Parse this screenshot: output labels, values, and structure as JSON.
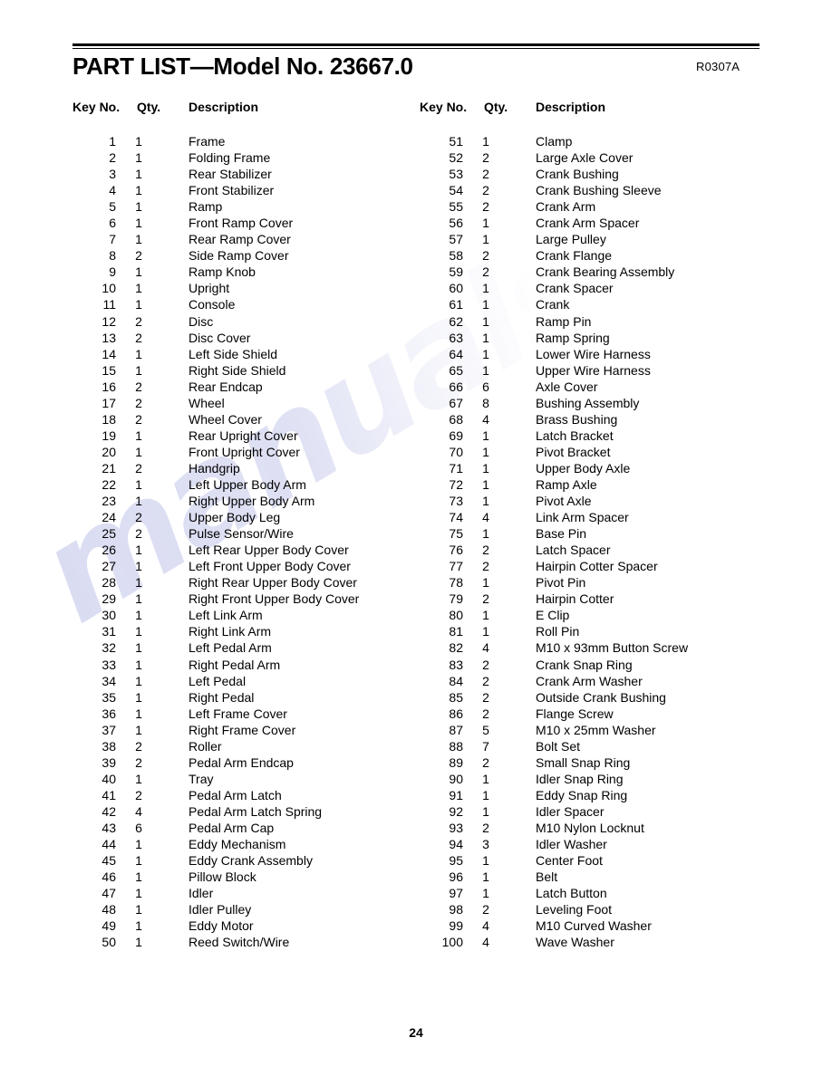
{
  "document": {
    "title": "PART LIST—Model No. 23667.0",
    "revision": "R0307A",
    "page_number": "24",
    "watermark": "manuals"
  },
  "columns": {
    "headers": {
      "key_no": "Key No.",
      "qty": "Qty.",
      "description": "Description"
    }
  },
  "parts_left": [
    {
      "key": "1",
      "qty": "1",
      "desc": "Frame"
    },
    {
      "key": "2",
      "qty": "1",
      "desc": "Folding Frame"
    },
    {
      "key": "3",
      "qty": "1",
      "desc": "Rear Stabilizer"
    },
    {
      "key": "4",
      "qty": "1",
      "desc": "Front Stabilizer"
    },
    {
      "key": "5",
      "qty": "1",
      "desc": "Ramp"
    },
    {
      "key": "6",
      "qty": "1",
      "desc": "Front Ramp Cover"
    },
    {
      "key": "7",
      "qty": "1",
      "desc": "Rear Ramp Cover"
    },
    {
      "key": "8",
      "qty": "2",
      "desc": "Side Ramp Cover"
    },
    {
      "key": "9",
      "qty": "1",
      "desc": "Ramp Knob"
    },
    {
      "key": "10",
      "qty": "1",
      "desc": "Upright"
    },
    {
      "key": "11",
      "qty": "1",
      "desc": "Console"
    },
    {
      "key": "12",
      "qty": "2",
      "desc": "Disc"
    },
    {
      "key": "13",
      "qty": "2",
      "desc": "Disc Cover"
    },
    {
      "key": "14",
      "qty": "1",
      "desc": "Left Side Shield"
    },
    {
      "key": "15",
      "qty": "1",
      "desc": "Right Side Shield"
    },
    {
      "key": "16",
      "qty": "2",
      "desc": "Rear Endcap"
    },
    {
      "key": "17",
      "qty": "2",
      "desc": "Wheel"
    },
    {
      "key": "18",
      "qty": "2",
      "desc": "Wheel Cover"
    },
    {
      "key": "19",
      "qty": "1",
      "desc": "Rear Upright Cover"
    },
    {
      "key": "20",
      "qty": "1",
      "desc": "Front Upright Cover"
    },
    {
      "key": "21",
      "qty": "2",
      "desc": "Handgrip"
    },
    {
      "key": "22",
      "qty": "1",
      "desc": "Left Upper Body Arm"
    },
    {
      "key": "23",
      "qty": "1",
      "desc": "Right Upper Body Arm"
    },
    {
      "key": "24",
      "qty": "2",
      "desc": "Upper Body Leg"
    },
    {
      "key": "25",
      "qty": "2",
      "desc": "Pulse Sensor/Wire"
    },
    {
      "key": "26",
      "qty": "1",
      "desc": "Left Rear Upper Body Cover"
    },
    {
      "key": "27",
      "qty": "1",
      "desc": "Left Front Upper Body Cover"
    },
    {
      "key": "28",
      "qty": "1",
      "desc": "Right Rear Upper Body Cover"
    },
    {
      "key": "29",
      "qty": "1",
      "desc": "Right Front Upper Body Cover"
    },
    {
      "key": "30",
      "qty": "1",
      "desc": "Left Link Arm"
    },
    {
      "key": "31",
      "qty": "1",
      "desc": "Right Link Arm"
    },
    {
      "key": "32",
      "qty": "1",
      "desc": "Left Pedal Arm"
    },
    {
      "key": "33",
      "qty": "1",
      "desc": "Right Pedal Arm"
    },
    {
      "key": "34",
      "qty": "1",
      "desc": "Left Pedal"
    },
    {
      "key": "35",
      "qty": "1",
      "desc": "Right Pedal"
    },
    {
      "key": "36",
      "qty": "1",
      "desc": "Left Frame Cover"
    },
    {
      "key": "37",
      "qty": "1",
      "desc": "Right Frame Cover"
    },
    {
      "key": "38",
      "qty": "2",
      "desc": "Roller"
    },
    {
      "key": "39",
      "qty": "2",
      "desc": "Pedal Arm Endcap"
    },
    {
      "key": "40",
      "qty": "1",
      "desc": "Tray"
    },
    {
      "key": "41",
      "qty": "2",
      "desc": "Pedal Arm Latch"
    },
    {
      "key": "42",
      "qty": "4",
      "desc": "Pedal Arm Latch Spring"
    },
    {
      "key": "43",
      "qty": "6",
      "desc": "Pedal Arm Cap"
    },
    {
      "key": "44",
      "qty": "1",
      "desc": "Eddy Mechanism"
    },
    {
      "key": "45",
      "qty": "1",
      "desc": "Eddy Crank Assembly"
    },
    {
      "key": "46",
      "qty": "1",
      "desc": "Pillow Block"
    },
    {
      "key": "47",
      "qty": "1",
      "desc": "Idler"
    },
    {
      "key": "48",
      "qty": "1",
      "desc": "Idler Pulley"
    },
    {
      "key": "49",
      "qty": "1",
      "desc": "Eddy Motor"
    },
    {
      "key": "50",
      "qty": "1",
      "desc": "Reed Switch/Wire"
    }
  ],
  "parts_right": [
    {
      "key": "51",
      "qty": "1",
      "desc": "Clamp"
    },
    {
      "key": "52",
      "qty": "2",
      "desc": "Large Axle Cover"
    },
    {
      "key": "53",
      "qty": "2",
      "desc": "Crank Bushing"
    },
    {
      "key": "54",
      "qty": "2",
      "desc": "Crank Bushing Sleeve"
    },
    {
      "key": "55",
      "qty": "2",
      "desc": "Crank Arm"
    },
    {
      "key": "56",
      "qty": "1",
      "desc": "Crank Arm Spacer"
    },
    {
      "key": "57",
      "qty": "1",
      "desc": "Large Pulley"
    },
    {
      "key": "58",
      "qty": "2",
      "desc": "Crank Flange"
    },
    {
      "key": "59",
      "qty": "2",
      "desc": "Crank Bearing Assembly"
    },
    {
      "key": "60",
      "qty": "1",
      "desc": "Crank Spacer"
    },
    {
      "key": "61",
      "qty": "1",
      "desc": "Crank"
    },
    {
      "key": "62",
      "qty": "1",
      "desc": "Ramp Pin"
    },
    {
      "key": "63",
      "qty": "1",
      "desc": "Ramp Spring"
    },
    {
      "key": "64",
      "qty": "1",
      "desc": "Lower Wire Harness"
    },
    {
      "key": "65",
      "qty": "1",
      "desc": "Upper Wire Harness"
    },
    {
      "key": "66",
      "qty": "6",
      "desc": "Axle Cover"
    },
    {
      "key": "67",
      "qty": "8",
      "desc": "Bushing Assembly"
    },
    {
      "key": "68",
      "qty": "4",
      "desc": "Brass Bushing"
    },
    {
      "key": "69",
      "qty": "1",
      "desc": "Latch Bracket"
    },
    {
      "key": "70",
      "qty": "1",
      "desc": "Pivot Bracket"
    },
    {
      "key": "71",
      "qty": "1",
      "desc": "Upper Body Axle"
    },
    {
      "key": "72",
      "qty": "1",
      "desc": "Ramp Axle"
    },
    {
      "key": "73",
      "qty": "1",
      "desc": "Pivot Axle"
    },
    {
      "key": "74",
      "qty": "4",
      "desc": "Link Arm Spacer"
    },
    {
      "key": "75",
      "qty": "1",
      "desc": "Base Pin"
    },
    {
      "key": "76",
      "qty": "2",
      "desc": "Latch Spacer"
    },
    {
      "key": "77",
      "qty": "2",
      "desc": "Hairpin Cotter Spacer"
    },
    {
      "key": "78",
      "qty": "1",
      "desc": "Pivot Pin"
    },
    {
      "key": "79",
      "qty": "2",
      "desc": "Hairpin Cotter"
    },
    {
      "key": "80",
      "qty": "1",
      "desc": "E Clip"
    },
    {
      "key": "81",
      "qty": "1",
      "desc": "Roll Pin"
    },
    {
      "key": "82",
      "qty": "4",
      "desc": "M10 x 93mm Button Screw"
    },
    {
      "key": "83",
      "qty": "2",
      "desc": "Crank Snap Ring"
    },
    {
      "key": "84",
      "qty": "2",
      "desc": "Crank Arm Washer"
    },
    {
      "key": "85",
      "qty": "2",
      "desc": "Outside Crank Bushing"
    },
    {
      "key": "86",
      "qty": "2",
      "desc": "Flange Screw"
    },
    {
      "key": "87",
      "qty": "5",
      "desc": "M10 x 25mm Washer"
    },
    {
      "key": "88",
      "qty": "7",
      "desc": "Bolt Set"
    },
    {
      "key": "89",
      "qty": "2",
      "desc": "Small Snap Ring"
    },
    {
      "key": "90",
      "qty": "1",
      "desc": "Idler Snap Ring"
    },
    {
      "key": "91",
      "qty": "1",
      "desc": "Eddy Snap Ring"
    },
    {
      "key": "92",
      "qty": "1",
      "desc": "Idler Spacer"
    },
    {
      "key": "93",
      "qty": "2",
      "desc": "M10 Nylon Locknut"
    },
    {
      "key": "94",
      "qty": "3",
      "desc": "Idler Washer"
    },
    {
      "key": "95",
      "qty": "1",
      "desc": "Center Foot"
    },
    {
      "key": "96",
      "qty": "1",
      "desc": "Belt"
    },
    {
      "key": "97",
      "qty": "1",
      "desc": "Latch Button"
    },
    {
      "key": "98",
      "qty": "2",
      "desc": "Leveling Foot"
    },
    {
      "key": "99",
      "qty": "4",
      "desc": "M10 Curved Washer"
    },
    {
      "key": "100",
      "qty": "4",
      "desc": "Wave Washer"
    }
  ]
}
